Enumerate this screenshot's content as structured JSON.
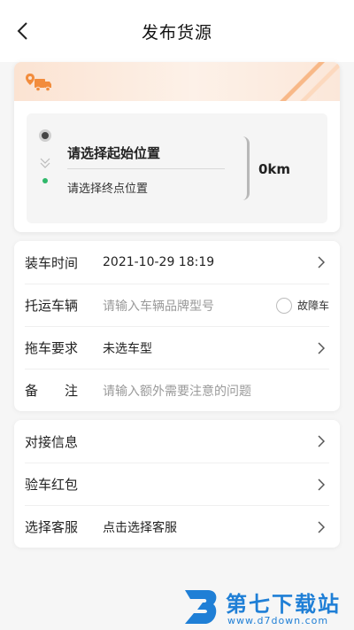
{
  "header": {
    "title": "发布货源"
  },
  "route": {
    "start_placeholder": "请选择起始位置",
    "end_placeholder": "请选择终点位置",
    "distance": "0km",
    "colors": {
      "banner": "#fbe3d2",
      "accent": "#f28c3c",
      "end_dot": "#2fb86a"
    }
  },
  "form": {
    "loading_time": {
      "label": "装车时间",
      "value": "2021-10-29 18:19"
    },
    "vehicle": {
      "label": "托运车辆",
      "placeholder": "请输入车辆品牌型号",
      "fault_label": "故障车"
    },
    "tow_requirement": {
      "label": "拖车要求",
      "value": "未选车型"
    },
    "remark": {
      "label": "备　　注",
      "placeholder": "请输入额外需要注意的问题"
    }
  },
  "extra": {
    "contact": {
      "label": "对接信息"
    },
    "red_packet": {
      "label": "验车红包"
    },
    "service": {
      "label": "选择客服",
      "value": "点击选择客服"
    }
  },
  "watermark": {
    "title": "第七下载站",
    "url": "www.d7down.com"
  }
}
